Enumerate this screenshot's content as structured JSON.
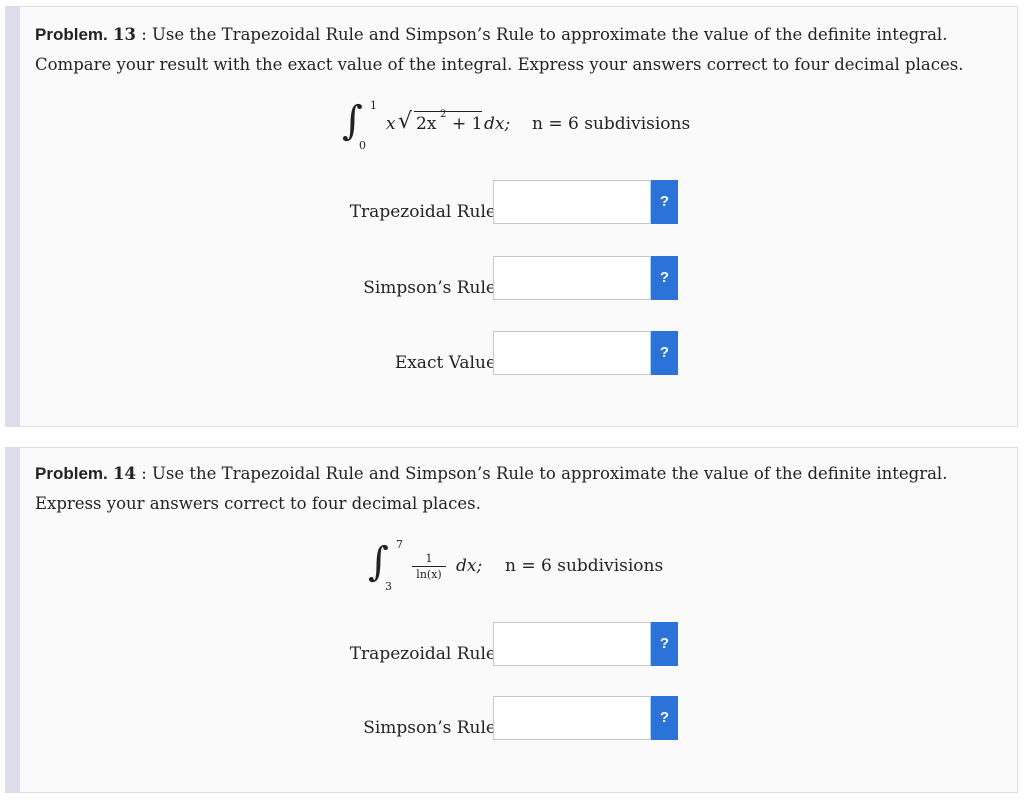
{
  "problems": [
    {
      "heading": "Problem.",
      "number": "13",
      "colon": ":",
      "text": "Use the Trapezoidal Rule and Simpson’s Rule to approximate the value of the definite integral. Compare your result with the exact value of the integral. Express your answers correct to four decimal places.",
      "integral": {
        "upper": "1",
        "lower": "0",
        "integrand_prefix": "x",
        "radicand_a": "2x",
        "radicand_exp": "2",
        "radicand_b": "+ 1",
        "dx": "dx;",
        "n_text": "n = 6 subdivisions"
      },
      "fields": [
        {
          "label": "Trapezoidal Rule",
          "value": "",
          "help": "?"
        },
        {
          "label": "Simpson’s Rule",
          "value": "",
          "help": "?"
        },
        {
          "label": "Exact Value",
          "value": "",
          "help": "?"
        }
      ]
    },
    {
      "heading": "Problem.",
      "number": "14",
      "colon": ":",
      "text": "Use the Trapezoidal Rule and Simpson’s Rule to approximate the value of the definite integral. Express your answers correct to four decimal places.",
      "integral": {
        "upper": "7",
        "lower": "3",
        "numerator": "1",
        "denominator": "ln(x)",
        "dx": "dx;",
        "n_text": "n = 6 subdivisions"
      },
      "fields": [
        {
          "label": "Trapezoidal Rule",
          "value": "",
          "help": "?"
        },
        {
          "label": "Simpson’s Rule",
          "value": "",
          "help": "?"
        }
      ]
    }
  ],
  "colors": {
    "help_button": "#2b72d9",
    "stripe": "#dcdde9"
  }
}
